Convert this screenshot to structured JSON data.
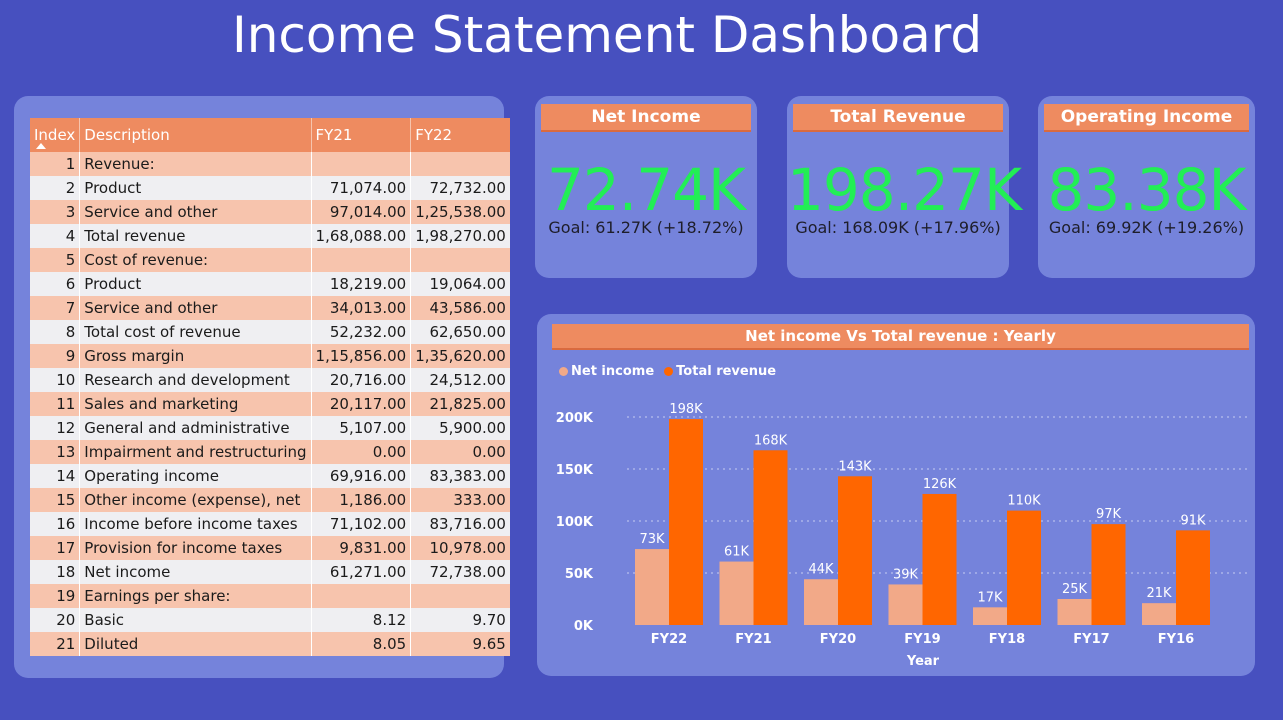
{
  "title": "Income Statement Dashboard",
  "table": {
    "columns": [
      "Index",
      "Description",
      "FY21",
      "FY22"
    ],
    "rows": [
      [
        "1",
        "Revenue:",
        "",
        ""
      ],
      [
        "2",
        "Product",
        "71,074.00",
        "72,732.00"
      ],
      [
        "3",
        "Service and other",
        "97,014.00",
        "1,25,538.00"
      ],
      [
        "4",
        "Total revenue",
        "1,68,088.00",
        "1,98,270.00"
      ],
      [
        "5",
        "Cost of revenue:",
        "",
        ""
      ],
      [
        "6",
        "Product",
        "18,219.00",
        "19,064.00"
      ],
      [
        "7",
        "Service and other",
        "34,013.00",
        "43,586.00"
      ],
      [
        "8",
        "Total cost of revenue",
        "52,232.00",
        "62,650.00"
      ],
      [
        "9",
        "Gross margin",
        "1,15,856.00",
        "1,35,620.00"
      ],
      [
        "10",
        "Research and development",
        "20,716.00",
        "24,512.00"
      ],
      [
        "11",
        "Sales and marketing",
        "20,117.00",
        "21,825.00"
      ],
      [
        "12",
        "General and administrative",
        "5,107.00",
        "5,900.00"
      ],
      [
        "13",
        "Impairment and restructuring",
        "0.00",
        "0.00"
      ],
      [
        "14",
        "Operating income",
        "69,916.00",
        "83,383.00"
      ],
      [
        "15",
        "Other income (expense), net",
        "1,186.00",
        "333.00"
      ],
      [
        "16",
        "Income before income taxes",
        "71,102.00",
        "83,716.00"
      ],
      [
        "17",
        "Provision for income taxes",
        "9,831.00",
        "10,978.00"
      ],
      [
        "18",
        "Net income",
        "61,271.00",
        "72,738.00"
      ],
      [
        "19",
        "Earnings per share:",
        "",
        ""
      ],
      [
        "20",
        "Basic",
        "8.12",
        "9.70"
      ],
      [
        "21",
        "Diluted",
        "8.05",
        "9.65"
      ]
    ]
  },
  "kpis": [
    {
      "label": "Net Income",
      "value": "72.74K",
      "goal": "Goal: 61.27K (+18.72%)"
    },
    {
      "label": "Total Revenue",
      "value": "198.27K",
      "goal": "Goal: 168.09K (+17.96%)"
    },
    {
      "label": "Operating Income",
      "value": "83.38K",
      "goal": "Goal: 69.92K (+19.26%)"
    }
  ],
  "colors": {
    "net_income": "#f2a988",
    "total_revenue": "#ff6600",
    "kpi_value": "#22ee55",
    "header": "#ee8b60"
  },
  "chart_data": {
    "type": "bar",
    "title": "Net income Vs Total revenue : Yearly",
    "xlabel": "Year",
    "ylabel": "",
    "categories": [
      "FY22",
      "FY21",
      "FY20",
      "FY19",
      "FY18",
      "FY17",
      "FY16"
    ],
    "series": [
      {
        "name": "Net income",
        "values": [
          73,
          61,
          44,
          39,
          17,
          25,
          21
        ],
        "labels": [
          "73K",
          "61K",
          "44K",
          "39K",
          "17K",
          "25K",
          "21K"
        ]
      },
      {
        "name": "Total revenue",
        "values": [
          198,
          168,
          143,
          126,
          110,
          97,
          91
        ],
        "labels": [
          "198K",
          "168K",
          "143K",
          "126K",
          "110K",
          "97K",
          "91K"
        ]
      }
    ],
    "yticks": [
      0,
      50,
      100,
      150,
      200
    ],
    "ytick_labels": [
      "0K",
      "50K",
      "100K",
      "150K",
      "200K"
    ],
    "ylim": [
      0,
      200
    ],
    "legend": "top-left",
    "grid": true
  }
}
